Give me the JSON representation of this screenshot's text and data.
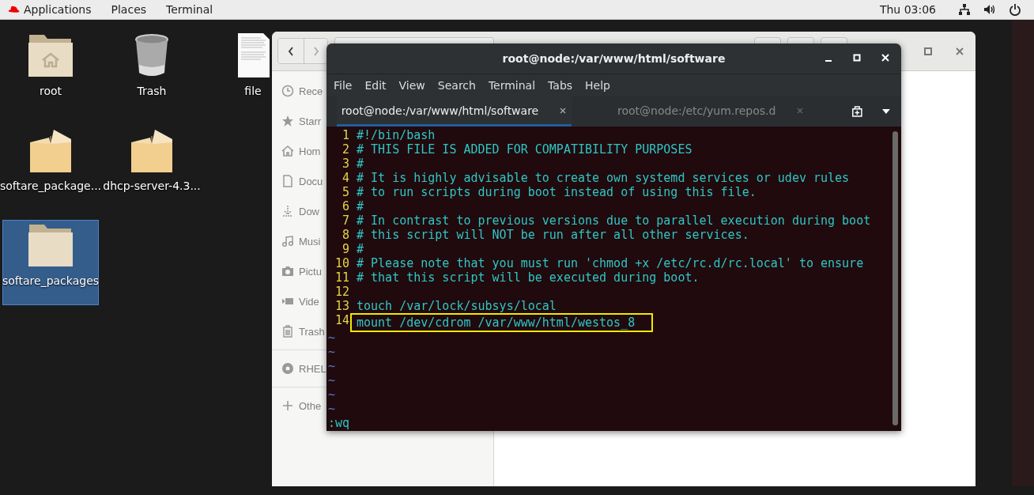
{
  "top_bar": {
    "menus": [
      "Applications",
      "Places",
      "Terminal"
    ],
    "clock": "Thu 03:06"
  },
  "desktop_icons": [
    {
      "label": "root",
      "kind": "home-folder",
      "selected": false
    },
    {
      "label": "Trash",
      "kind": "trash",
      "selected": false
    },
    {
      "label": "file",
      "kind": "document",
      "selected": false
    },
    {
      "label": "softare_package...",
      "kind": "package",
      "selected": false
    },
    {
      "label": "dhcp-server-4.3...",
      "kind": "package",
      "selected": false
    },
    {
      "label": "softare_packages",
      "kind": "folder",
      "selected": true
    }
  ],
  "file_manager": {
    "sidebar": [
      {
        "label": "Rece",
        "kind": "clock"
      },
      {
        "label": "Starr",
        "kind": "star"
      },
      {
        "label": "Hom",
        "kind": "home"
      },
      {
        "label": "Docu",
        "kind": "document"
      },
      {
        "label": "Dow",
        "kind": "download"
      },
      {
        "label": "Musi",
        "kind": "music"
      },
      {
        "label": "Pictu",
        "kind": "camera"
      },
      {
        "label": "Vide",
        "kind": "video"
      },
      {
        "label": "Trash",
        "kind": "trash"
      },
      {
        "label": "RHEL",
        "kind": "disc"
      },
      {
        "label": "Othe",
        "kind": "plus"
      }
    ]
  },
  "terminal": {
    "title": "root@node:/var/www/html/software",
    "menu": [
      "File",
      "Edit",
      "View",
      "Search",
      "Terminal",
      "Tabs",
      "Help"
    ],
    "tabs": [
      {
        "label": "root@node:/var/www/html/software",
        "selected": true
      },
      {
        "label": "root@node:/etc/yum.repos.d",
        "selected": false
      }
    ],
    "lines": [
      {
        "number": "1",
        "text": "#!/bin/bash",
        "highlighted": false
      },
      {
        "number": "2",
        "text": "# THIS FILE IS ADDED FOR COMPATIBILITY PURPOSES",
        "highlighted": false
      },
      {
        "number": "3",
        "text": "#",
        "highlighted": false
      },
      {
        "number": "4",
        "text": "# It is highly advisable to create own systemd services or udev rules",
        "highlighted": false
      },
      {
        "number": "5",
        "text": "# to run scripts during boot instead of using this file.",
        "highlighted": false
      },
      {
        "number": "6",
        "text": "#",
        "highlighted": false
      },
      {
        "number": "7",
        "text": "# In contrast to previous versions due to parallel execution during boot",
        "highlighted": false
      },
      {
        "number": "8",
        "text": "# this script will NOT be run after all other services.",
        "highlighted": false
      },
      {
        "number": "9",
        "text": "#",
        "highlighted": false
      },
      {
        "number": "10",
        "text": "# Please note that you must run 'chmod +x /etc/rc.d/rc.local' to ensure",
        "highlighted": false
      },
      {
        "number": "11",
        "text": "# that this script will be executed during boot.",
        "highlighted": false
      },
      {
        "number": "12",
        "highlighted": false
      },
      {
        "number": "13",
        "text": "touch /var/lock/subsys/local",
        "highlighted": false
      },
      {
        "number": "14",
        "text": "mount /dev/cdrom /var/www/html/westos_8",
        "highlighted": true
      }
    ],
    "filler_lines": [
      "~",
      "~",
      "~",
      "~",
      "~",
      "~"
    ],
    "command_line": ":wq"
  }
}
